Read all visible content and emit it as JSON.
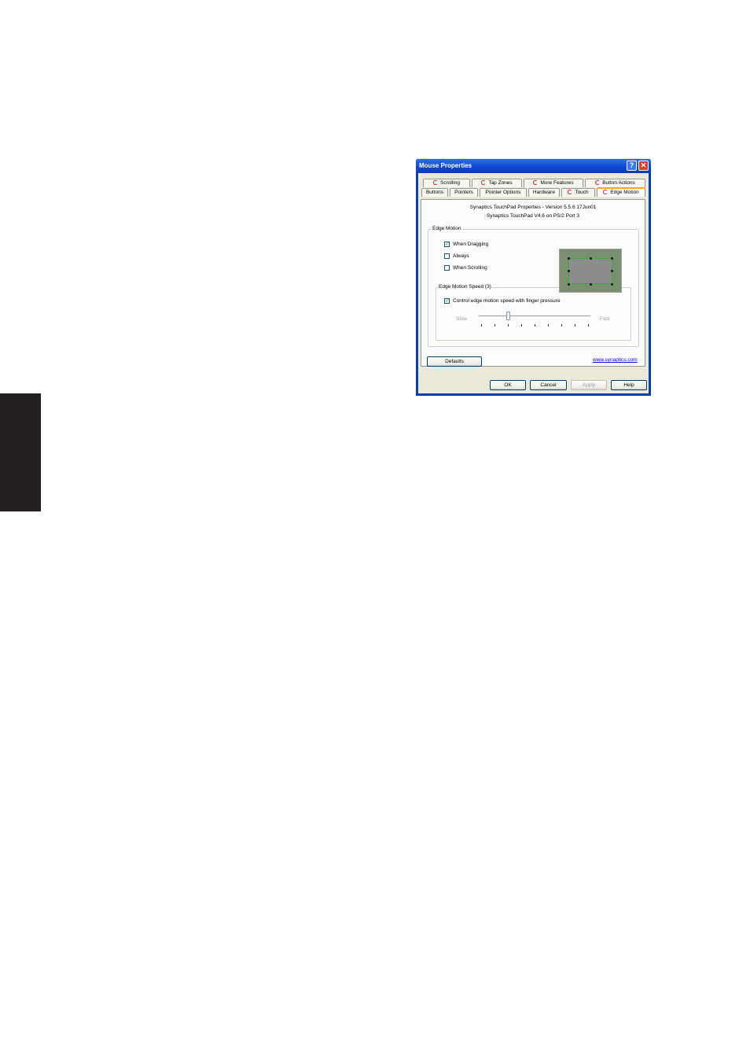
{
  "window": {
    "title": "Mouse Properties"
  },
  "tabs_row1": [
    {
      "label": "Scrolling",
      "icon": "synaptics-icon"
    },
    {
      "label": "Tap Zones",
      "icon": "synaptics-icon"
    },
    {
      "label": "More Features",
      "icon": "synaptics-icon"
    },
    {
      "label": "Button Actions",
      "icon": "synaptics-icon"
    }
  ],
  "tabs_row2": [
    {
      "label": "Buttons"
    },
    {
      "label": "Pointers"
    },
    {
      "label": "Pointer Options"
    },
    {
      "label": "Hardware"
    },
    {
      "label": "Touch",
      "icon": "synaptics-icon"
    },
    {
      "label": "Edge Motion",
      "icon": "synaptics-icon",
      "active": true
    }
  ],
  "info": {
    "line1": "Synaptics TouchPad Properties - Version 5.5.6 17Jun01",
    "line2": "Synaptics TouchPad V4.6 on PS/2 Port 3"
  },
  "edge_motion": {
    "legend": "Edge Motion",
    "options": [
      {
        "label": "When Dragging",
        "checked": true
      },
      {
        "label": "Always",
        "checked": false
      },
      {
        "label": "When Scrolling",
        "checked": false
      }
    ]
  },
  "speed": {
    "legend": "Edge Motion Speed (3)",
    "control_label": "Control edge motion speed with finger pressure",
    "control_checked": true,
    "slow_label": "Slow",
    "fast_label": "Fast",
    "value": 3,
    "min": 1,
    "max": 9
  },
  "footer": {
    "defaults_label": "Defaults",
    "link_text": "www.synaptics.com"
  },
  "buttons": {
    "ok": "OK",
    "cancel": "Cancel",
    "apply": "Apply",
    "help": "Help"
  },
  "colors": {
    "title_bar": "#0a46d4",
    "active_tab_accent": "#f5a623",
    "touchpad_frame": "#3ea83e"
  }
}
